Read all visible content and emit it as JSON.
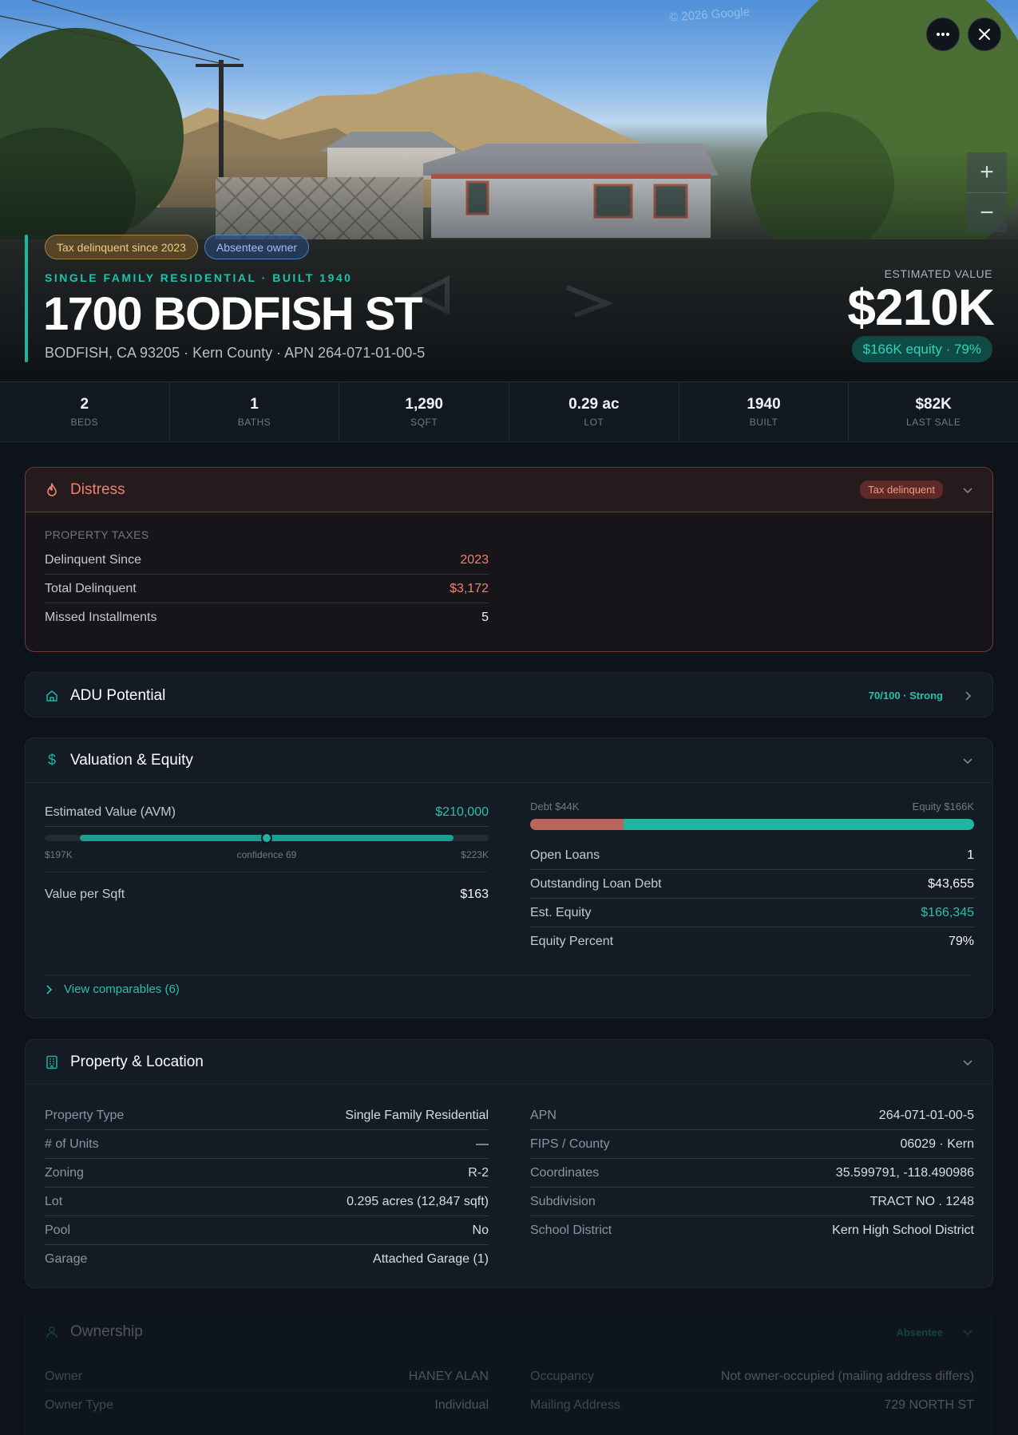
{
  "hero": {
    "watermark": "© 2026 Google",
    "chips": {
      "tax": "Tax delinquent since 2023",
      "absentee": "Absentee owner"
    },
    "subtitle": "SINGLE FAMILY RESIDENTIAL · BUILT 1940",
    "title": "1700 BODFISH ST",
    "address": "BODFISH, CA 93205 · Kern County · APN 264-071-01-00-5",
    "estimate_label": "ESTIMATED VALUE",
    "estimate_value": "$210K",
    "equity_pill": "$166K equity · 79%",
    "zoom_in": "+",
    "zoom_out": "−"
  },
  "stats": [
    {
      "value": "2",
      "label": "BEDS"
    },
    {
      "value": "1",
      "label": "BATHS"
    },
    {
      "value": "1,290",
      "label": "SQFT"
    },
    {
      "value": "0.29 ac",
      "label": "LOT"
    },
    {
      "value": "1940",
      "label": "BUILT"
    },
    {
      "value": "$82K",
      "label": "LAST SALE"
    }
  ],
  "distress": {
    "title": "Distress",
    "badge": "Tax delinquent",
    "section": "PROPERTY TAXES",
    "rows": [
      {
        "k": "Delinquent Since",
        "v": "2023"
      },
      {
        "k": "Total Delinquent",
        "v": "$3,172"
      },
      {
        "k": "Missed Installments",
        "v": "5"
      }
    ]
  },
  "adu": {
    "title": "ADU Potential",
    "score": "70/100 · Strong"
  },
  "valuation": {
    "title": "Valuation & Equity",
    "avm_label": "Estimated Value (AVM)",
    "avm_value": "$210,000",
    "range_low": "$197K",
    "range_high": "$223K",
    "confidence": "confidence 69",
    "per_sqft_label": "Value per Sqft",
    "per_sqft_value": "$163",
    "debt_label": "Debt $44K",
    "equity_label": "Equity $166K",
    "equity_fraction": 0.79,
    "rows": [
      {
        "k": "Open Loans",
        "v": "1"
      },
      {
        "k": "Outstanding Loan Debt",
        "v": "$43,655"
      },
      {
        "k": "Est. Equity",
        "v": "$166,345"
      },
      {
        "k": "Equity Percent",
        "v": "79%"
      }
    ],
    "comps_link": "View comparables (6)"
  },
  "property": {
    "title": "Property & Location",
    "left": [
      {
        "k": "Property Type",
        "v": "Single Family Residential"
      },
      {
        "k": "# of Units",
        "v": "—"
      },
      {
        "k": "Zoning",
        "v": "R-2"
      },
      {
        "k": "Lot",
        "v": "0.295 acres (12,847 sqft)"
      },
      {
        "k": "Pool",
        "v": "No"
      },
      {
        "k": "Garage",
        "v": "Attached Garage (1)"
      }
    ],
    "right": [
      {
        "k": "APN",
        "v": "264-071-01-00-5"
      },
      {
        "k": "FIPS / County",
        "v": "06029 · Kern"
      },
      {
        "k": "Coordinates",
        "v": "35.599791, -118.490986"
      },
      {
        "k": "Subdivision",
        "v": "TRACT NO . 1248"
      },
      {
        "k": "School District",
        "v": "Kern High School District"
      }
    ]
  },
  "ownership": {
    "title": "Ownership",
    "badge": "Absentee",
    "left": [
      {
        "k": "Owner",
        "v": "HANEY ALAN"
      },
      {
        "k": "Owner Type",
        "v": "Individual"
      }
    ],
    "right": [
      {
        "k": "Occupancy",
        "v": "Not owner-occupied (mailing address differs)"
      },
      {
        "k": "Mailing Address",
        "v": "729 NORTH ST"
      }
    ]
  },
  "colors": {
    "accent": "#1fb5a1",
    "danger": "#f0806f",
    "debt": "#b9665a",
    "background": "#0e131b"
  },
  "icons": [
    "more-icon",
    "close-icon",
    "flame-icon",
    "home-icon",
    "dollar-icon",
    "building-icon",
    "user-icon",
    "chevron-down-icon",
    "chevron-right-icon"
  ]
}
